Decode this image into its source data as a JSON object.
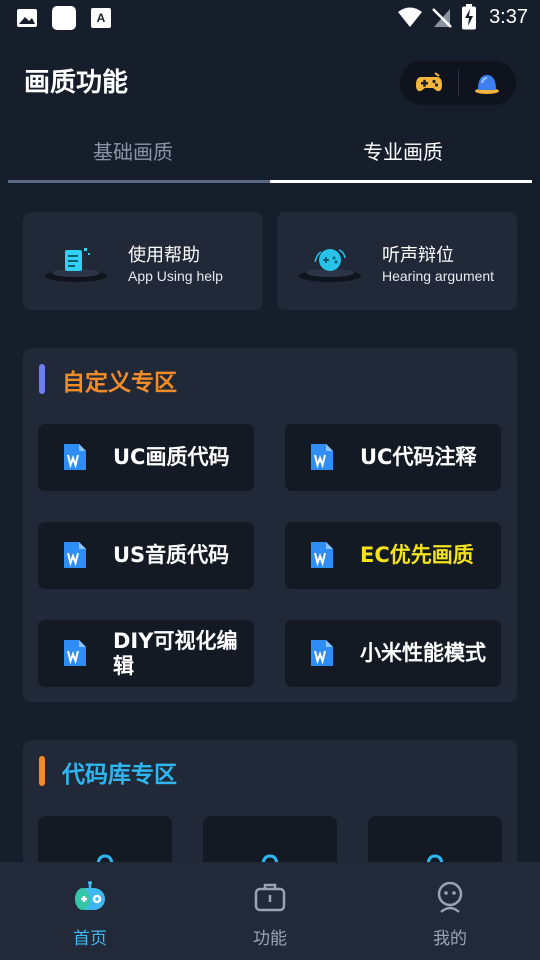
{
  "status_bar": {
    "time": "3:37"
  },
  "header": {
    "title": "画质功能"
  },
  "tabs": [
    {
      "label": "基础画质"
    },
    {
      "label": "专业画质"
    }
  ],
  "help_cards": [
    {
      "title": "使用帮助",
      "subtitle": "App Using help"
    },
    {
      "title": "听声辩位",
      "subtitle": "Hearing argument"
    }
  ],
  "custom_section": {
    "title": "自定义专区",
    "title_color": "#f28c28",
    "bar_color": "#6f7df0",
    "items": [
      {
        "label": "UC画质代码",
        "color": "#ffffff"
      },
      {
        "label": "UC代码注释",
        "color": "#ffffff"
      },
      {
        "label": "US音质代码",
        "color": "#ffffff"
      },
      {
        "label": "EC优先画质",
        "color": "#f4e21a"
      },
      {
        "label": "DIY可视化编辑",
        "color": "#ffffff"
      },
      {
        "label": "小米性能模式",
        "color": "#ffffff"
      }
    ]
  },
  "codelib_section": {
    "title": "代码库专区",
    "title_color": "#2fb6f0",
    "bar_color": "#f28c28"
  },
  "bottom_nav": [
    {
      "label": "首页",
      "icon": "home-robot-icon",
      "active": true
    },
    {
      "label": "功能",
      "icon": "briefcase-icon",
      "active": false
    },
    {
      "label": "我的",
      "icon": "user-face-icon",
      "active": false
    }
  ],
  "colors": {
    "background": "#161d2b",
    "card": "#212938",
    "button": "#141a24",
    "accent": "#3fb8f0"
  }
}
